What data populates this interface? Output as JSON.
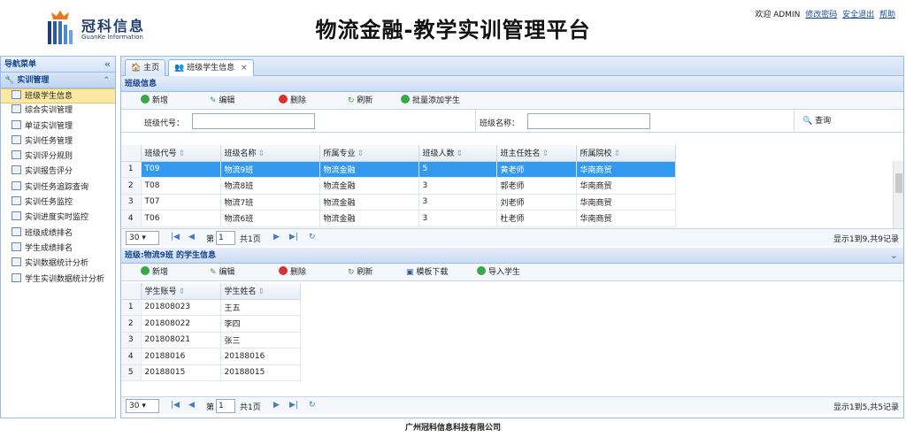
{
  "brand": {
    "name_cn": "冠科信息",
    "name_en": "GuanKe Information"
  },
  "app_title": "物流金融-教学实训管理平台",
  "top": {
    "welcome": "欢迎 ADMIN",
    "change_password": "修改密码",
    "logout": "安全退出",
    "help": "帮助"
  },
  "sidebar": {
    "title": "导航菜单",
    "group": "实训管理",
    "items": [
      {
        "label": "班级学生信息"
      },
      {
        "label": "综合实训管理"
      },
      {
        "label": "单证实训管理"
      },
      {
        "label": "实训任务管理"
      },
      {
        "label": "实训评分规则"
      },
      {
        "label": "实训报告评分"
      },
      {
        "label": "实训任务追踪查询"
      },
      {
        "label": "实训任务监控"
      },
      {
        "label": "实训进度实时监控"
      },
      {
        "label": "班级成绩排名"
      },
      {
        "label": "学生成绩排名"
      },
      {
        "label": "实训数据统计分析"
      },
      {
        "label": "学生实训数据统计分析"
      }
    ]
  },
  "tabs": [
    {
      "label": "主页"
    },
    {
      "label": "班级学生信息",
      "close": "×"
    }
  ],
  "class_panel": {
    "title": "班级信息",
    "toolbar": {
      "add": "新增",
      "edit": "编辑",
      "delete": "删除",
      "refresh": "刷新",
      "batch_add": "批量添加学生"
    },
    "search": {
      "code_label": "班级代号：",
      "name_label": "班级名称：",
      "query": "查询"
    },
    "columns": [
      "班级代号",
      "班级名称",
      "所属专业",
      "班级人数",
      "班主任姓名",
      "所属院校"
    ],
    "rows": [
      {
        "n": "1",
        "code": "T09",
        "name": "物流9班",
        "major": "物流金融",
        "count": "5",
        "teacher": "黄老师",
        "school": "华南商贸"
      },
      {
        "n": "2",
        "code": "T08",
        "name": "物流8班",
        "major": "物流金融",
        "count": "3",
        "teacher": "郭老师",
        "school": "华南商贸"
      },
      {
        "n": "3",
        "code": "T07",
        "name": "物流7班",
        "major": "物流金融",
        "count": "3",
        "teacher": "刘老师",
        "school": "华南商贸"
      },
      {
        "n": "4",
        "code": "T06",
        "name": "物流6班",
        "major": "物流金融",
        "count": "3",
        "teacher": "杜老师",
        "school": "华南商贸"
      }
    ],
    "pager": {
      "size": "30",
      "page_prefix": "第",
      "page": "1",
      "page_suffix": "共1页",
      "info": "显示1到9,共9记录"
    }
  },
  "student_panel": {
    "title": "班级:物流9班 的学生信息",
    "toolbar": {
      "add": "新增",
      "edit": "编辑",
      "delete": "删除",
      "refresh": "刷新",
      "template": "模板下载",
      "import": "导入学生"
    },
    "columns": [
      "学生账号",
      "学生姓名"
    ],
    "rows": [
      {
        "n": "1",
        "account": "201808023",
        "name": "王五"
      },
      {
        "n": "2",
        "account": "201808022",
        "name": "李四"
      },
      {
        "n": "3",
        "account": "201808021",
        "name": "张三"
      },
      {
        "n": "4",
        "account": "20188016",
        "name": "20188016"
      },
      {
        "n": "5",
        "account": "20188015",
        "name": "20188015"
      }
    ],
    "pager": {
      "size": "30",
      "page_prefix": "第",
      "page": "1",
      "page_suffix": "共1页",
      "info": "显示1到5,共5记录"
    }
  },
  "footer": "广州冠科信息科技有限公司",
  "colors": {
    "accent": "#99bbe8",
    "selected_row": "#3399ee",
    "active_menu": "#fbe9a3",
    "brand": "#1f3f6e"
  }
}
